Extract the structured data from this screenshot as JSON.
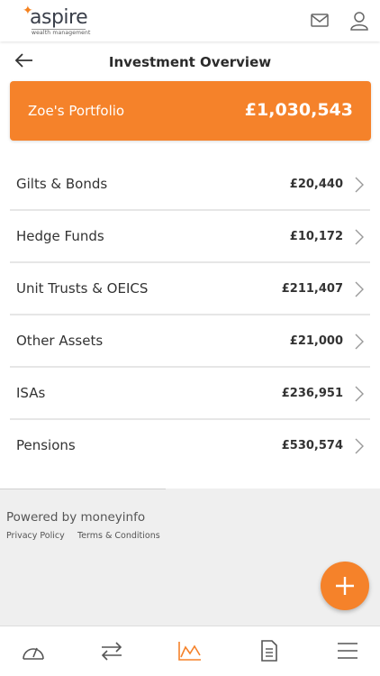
{
  "brand": {
    "name": "aspire",
    "tagline": "wealth management",
    "accent": "#f5822a"
  },
  "header": {
    "title": "Investment Overview",
    "icons": [
      "back-arrow-icon",
      "mail-icon",
      "user-icon"
    ]
  },
  "portfolio": {
    "name": "Zoe's Portfolio",
    "value": "£1,030,543"
  },
  "holdings": [
    {
      "label": "Gilts & Bonds",
      "value": "£20,440"
    },
    {
      "label": "Hedge Funds",
      "value": "£10,172"
    },
    {
      "label": "Unit Trusts & OEICS",
      "value": "£211,407"
    },
    {
      "label": "Other Assets",
      "value": "£21,000"
    },
    {
      "label": "ISAs",
      "value": "£236,951"
    },
    {
      "label": "Pensions",
      "value": "£530,574"
    }
  ],
  "footer": {
    "powered_by": "Powered by moneyinfo",
    "privacy": "Privacy Policy",
    "terms": "Terms & Conditions"
  },
  "bottom_nav": {
    "items": [
      "dashboard-icon",
      "transfer-icon",
      "chart-icon",
      "document-icon",
      "menu-icon"
    ],
    "active": "chart-icon"
  }
}
